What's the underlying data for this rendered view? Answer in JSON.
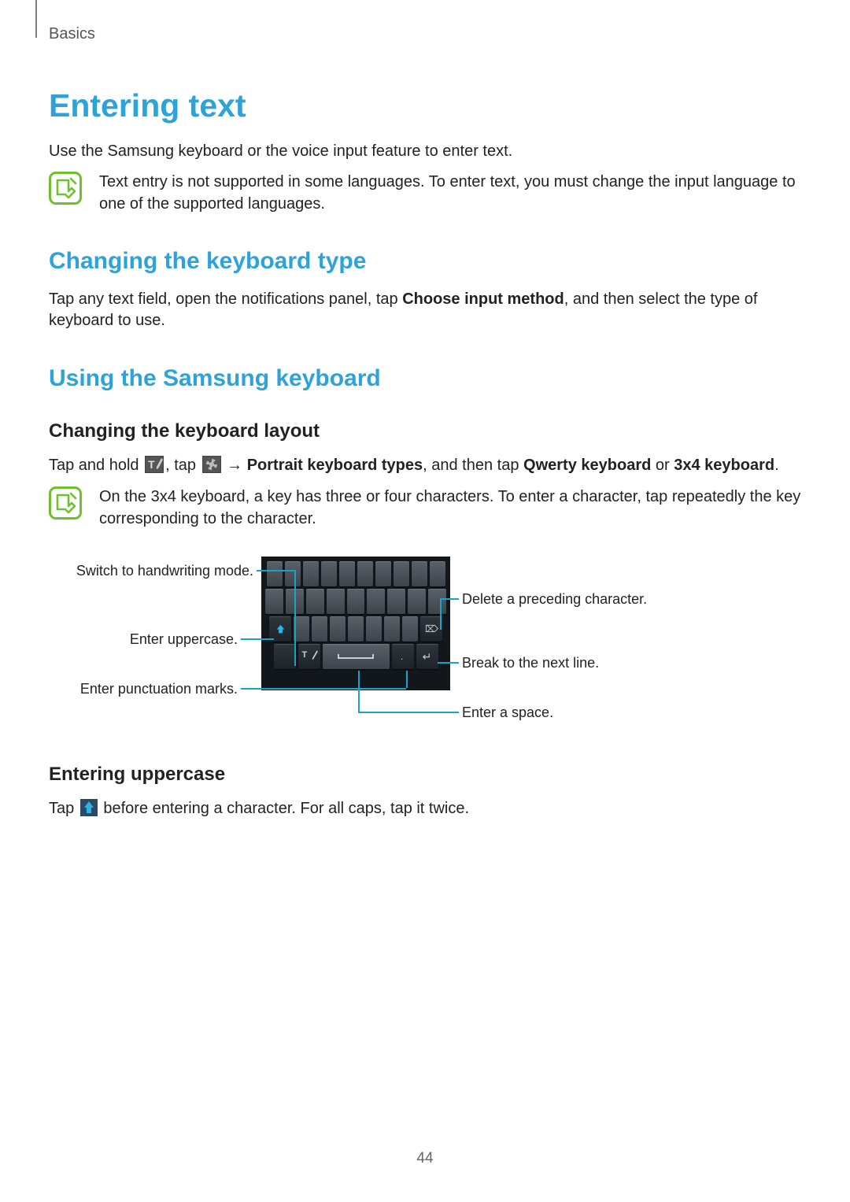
{
  "header": {
    "section": "Basics"
  },
  "h1": "Entering text",
  "intro": "Use the Samsung keyboard or the voice input feature to enter text.",
  "note1": "Text entry is not supported in some languages. To enter text, you must change the input language to one of the supported languages.",
  "h2a": "Changing the keyboard type",
  "para_change_type_pre": "Tap any text field, open the notifications panel, tap ",
  "para_change_type_bold": "Choose input method",
  "para_change_type_post": ", and then select the type of keyboard to use.",
  "h2b": "Using the Samsung keyboard",
  "h3a": "Changing the keyboard layout",
  "layout_pre": "Tap and hold ",
  "layout_mid1": ", tap ",
  "layout_arrow": " → ",
  "layout_bold1": "Portrait keyboard types",
  "layout_mid2": ", and then tap ",
  "layout_bold2": "Qwerty keyboard",
  "layout_or": " or ",
  "layout_bold3": "3x4 keyboard",
  "layout_period": ".",
  "note2": "On the 3x4 keyboard, a key has three or four characters. To enter a character, tap repeatedly the key corresponding to the character.",
  "callouts": {
    "handwriting": "Switch to handwriting mode.",
    "uppercase": "Enter uppercase.",
    "punctuation": "Enter punctuation marks.",
    "delete": "Delete a preceding character.",
    "nextline": "Break to the next line.",
    "space": "Enter a space."
  },
  "h3b": "Entering uppercase",
  "upper_pre": "Tap ",
  "upper_post": " before entering a character. For all caps, tap it twice.",
  "page": "44",
  "colors": {
    "accent": "#2da3d8",
    "note_green": "#6fbf2f",
    "line_blue": "#1aa3c4"
  }
}
